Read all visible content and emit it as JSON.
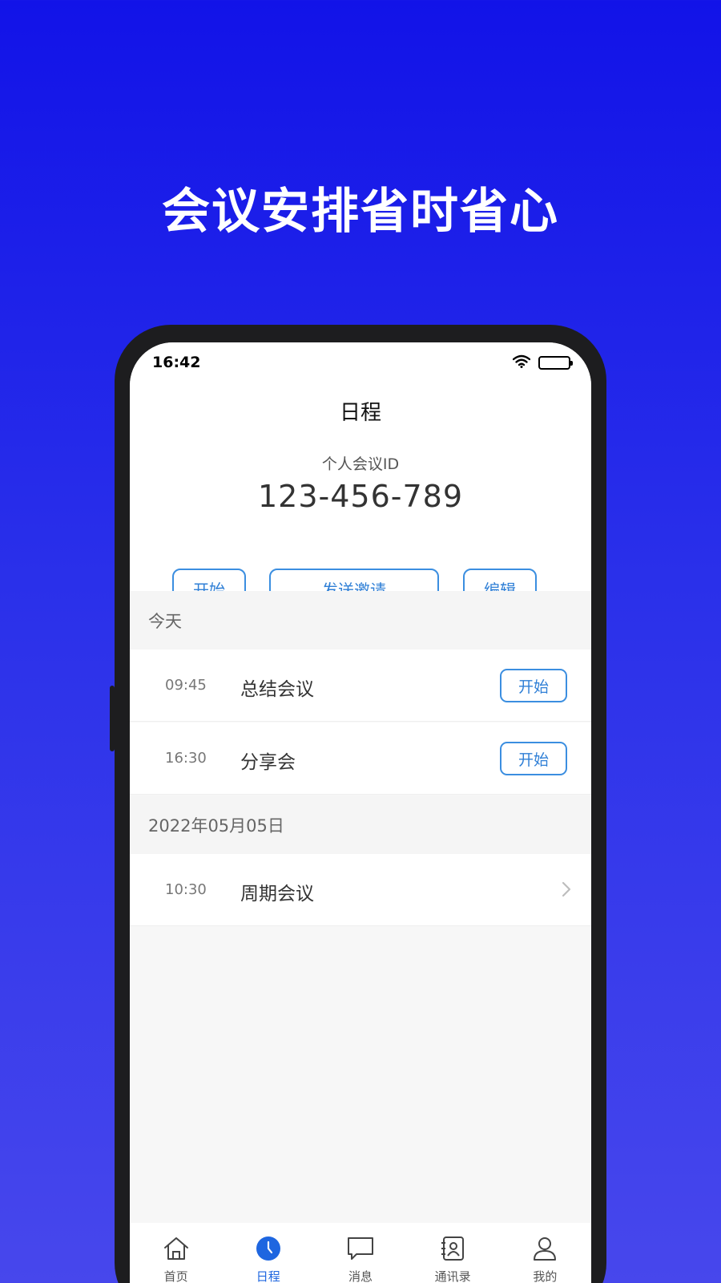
{
  "headline": "会议安排省时省心",
  "status_bar": {
    "time": "16:42"
  },
  "header": {
    "title": "日程"
  },
  "meeting_id": {
    "label": "个人会议ID",
    "value": "123-456-789",
    "buttons": {
      "start": "开始",
      "send_invite": "发送邀请",
      "edit": "编辑"
    }
  },
  "sections": [
    {
      "title": "今天",
      "items": [
        {
          "time": "09:45",
          "title": "总结会议",
          "action": "开始"
        },
        {
          "time": "16:30",
          "title": "分享会",
          "action": "开始"
        }
      ]
    },
    {
      "title": "2022年05月05日",
      "items": [
        {
          "time": "10:30",
          "title": "周期会议"
        }
      ]
    }
  ],
  "tabbar": {
    "items": [
      {
        "label": "首页",
        "icon": "home-icon"
      },
      {
        "label": "日程",
        "icon": "clock-icon",
        "active": true
      },
      {
        "label": "消息",
        "icon": "message-icon"
      },
      {
        "label": "通讯录",
        "icon": "contacts-icon"
      },
      {
        "label": "我的",
        "icon": "profile-icon"
      }
    ]
  },
  "colors": {
    "accent": "#2f7fd6",
    "tab_active": "#1e66e0",
    "background_top": "#1213e8",
    "background_bottom": "#4747ec"
  }
}
